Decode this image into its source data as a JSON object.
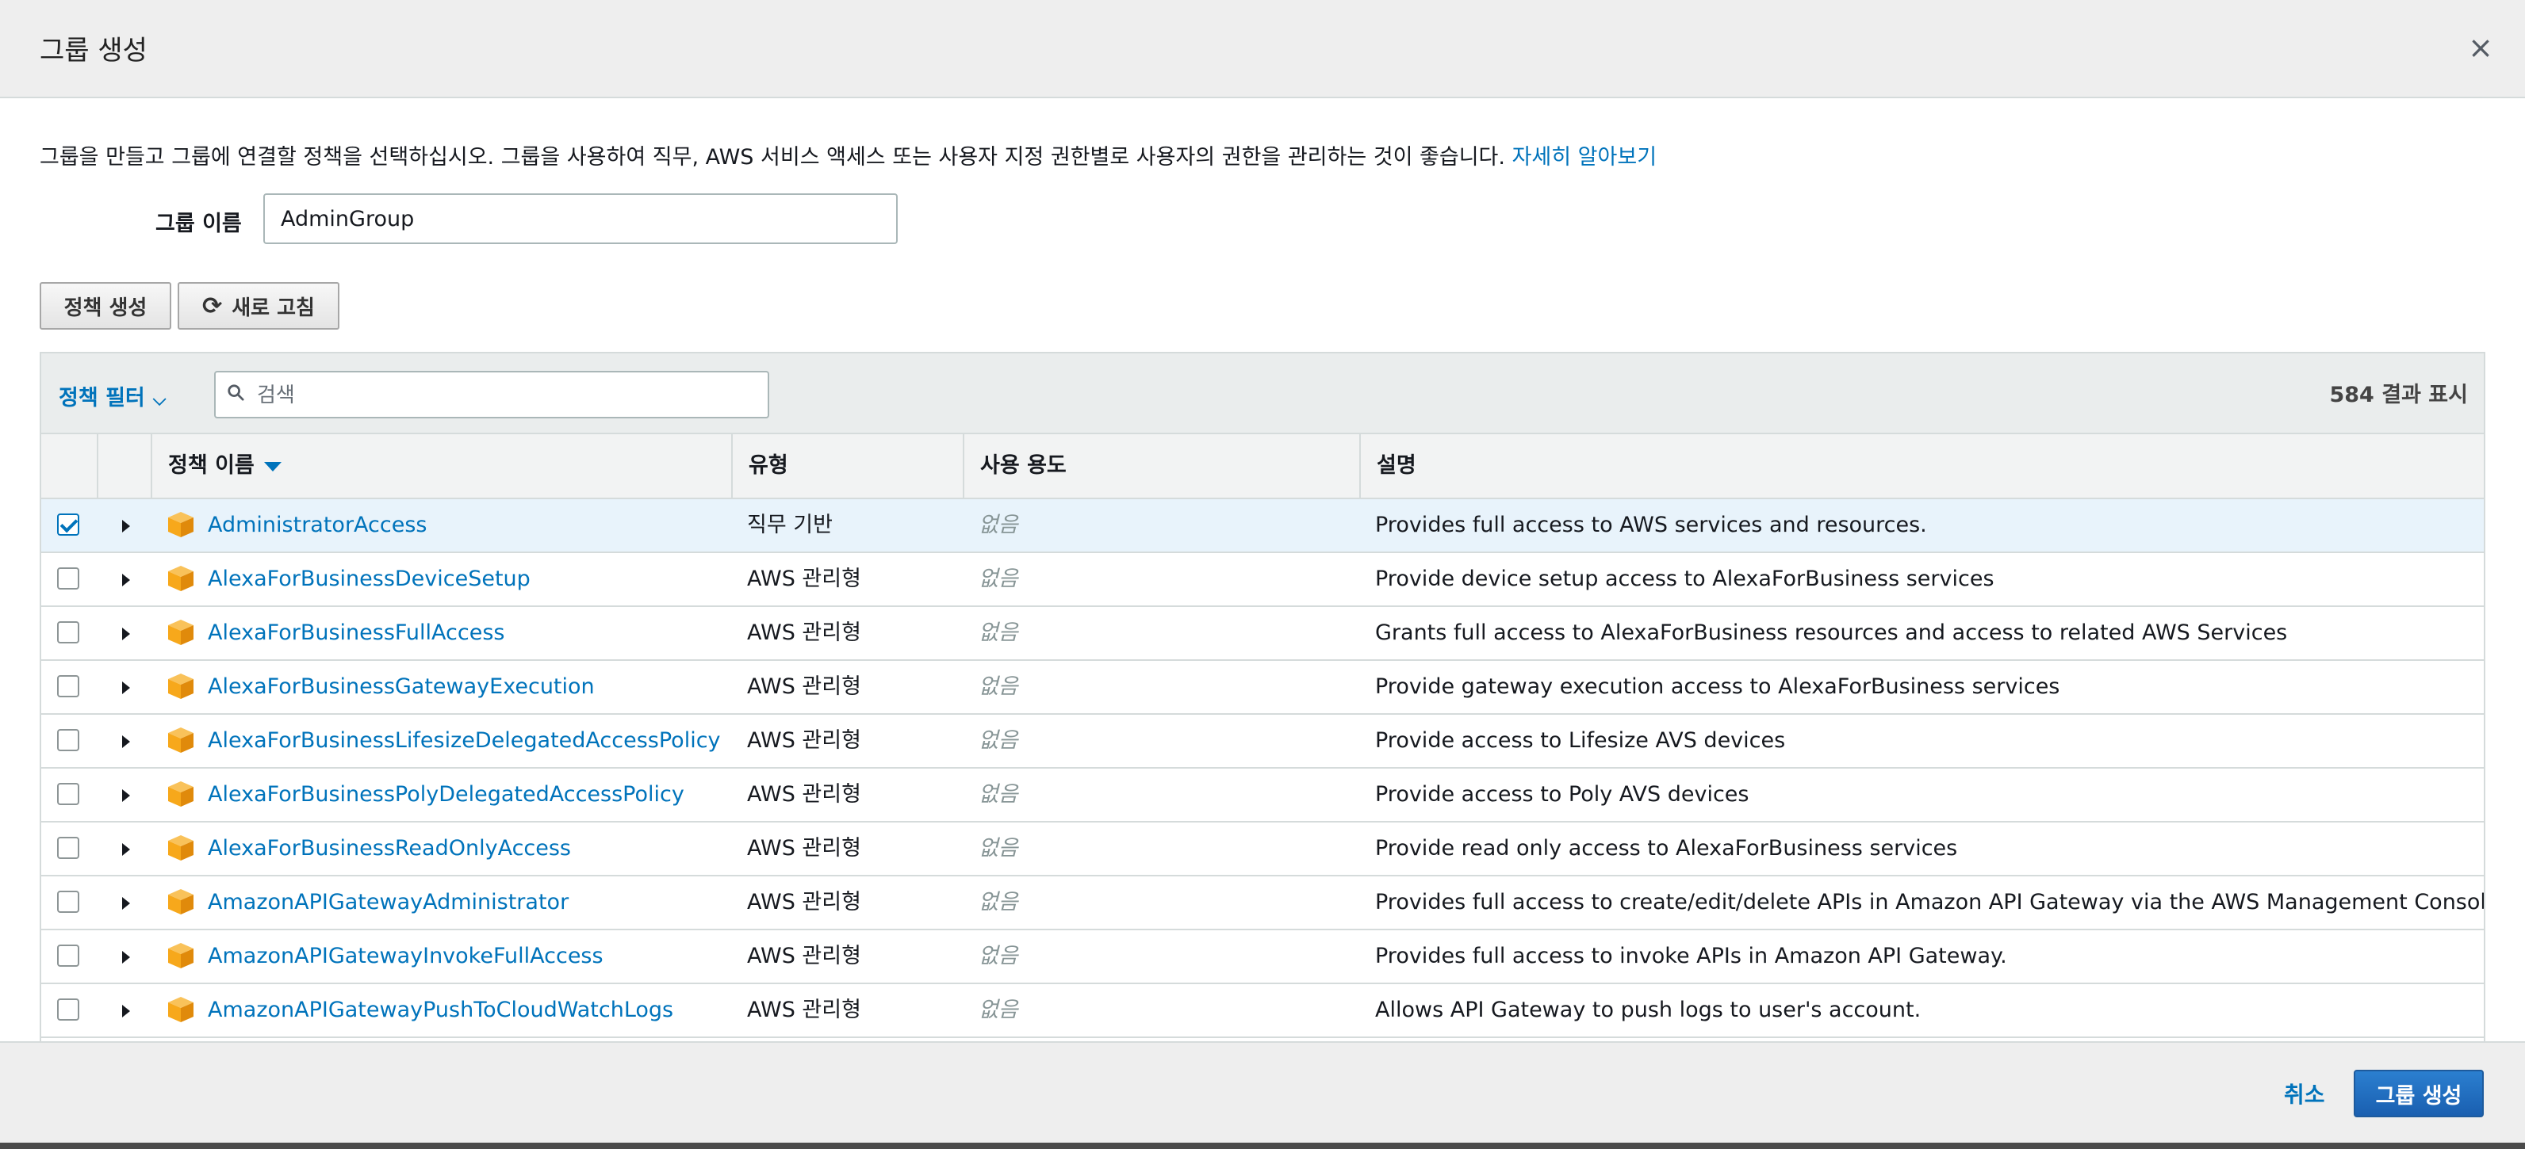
{
  "dialog": {
    "title": "그룹 생성",
    "close_glyph": "×"
  },
  "intro": {
    "text": "그룹을 만들고 그룹에 연결할 정책을 선택하십시오. 그룹을 사용하여 직무, AWS 서비스 액세스 또는 사용자 지정 권한별로 사용자의 권한을 관리하는 것이 좋습니다.",
    "link": "자세히 알아보기"
  },
  "group_name": {
    "label": "그룹 이름",
    "value": "AdminGroup"
  },
  "actions": {
    "create_policy": "정책 생성",
    "refresh": "새로 고침"
  },
  "toolbar": {
    "filter_label": "정책 필터",
    "search_placeholder": "검색",
    "result_count": "584 결과 표시"
  },
  "columns": {
    "name": "정책 이름",
    "type": "유형",
    "usage": "사용 용도",
    "description": "설명"
  },
  "rows": [
    {
      "name": "AdministratorAccess",
      "type": "직무 기반",
      "usage": "없음",
      "description": "Provides full access to AWS services and resources.",
      "checked": true
    },
    {
      "name": "AlexaForBusinessDeviceSetup",
      "type": "AWS 관리형",
      "usage": "없음",
      "description": "Provide device setup access to AlexaForBusiness services",
      "checked": false
    },
    {
      "name": "AlexaForBusinessFullAccess",
      "type": "AWS 관리형",
      "usage": "없음",
      "description": "Grants full access to AlexaForBusiness resources and access to related AWS Services",
      "checked": false
    },
    {
      "name": "AlexaForBusinessGatewayExecution",
      "type": "AWS 관리형",
      "usage": "없음",
      "description": "Provide gateway execution access to AlexaForBusiness services",
      "checked": false
    },
    {
      "name": "AlexaForBusinessLifesizeDelegatedAccessPolicy",
      "type": "AWS 관리형",
      "usage": "없음",
      "description": "Provide access to Lifesize AVS devices",
      "checked": false
    },
    {
      "name": "AlexaForBusinessPolyDelegatedAccessPolicy",
      "type": "AWS 관리형",
      "usage": "없음",
      "description": "Provide access to Poly AVS devices",
      "checked": false
    },
    {
      "name": "AlexaForBusinessReadOnlyAccess",
      "type": "AWS 관리형",
      "usage": "없음",
      "description": "Provide read only access to AlexaForBusiness services",
      "checked": false
    },
    {
      "name": "AmazonAPIGatewayAdministrator",
      "type": "AWS 관리형",
      "usage": "없음",
      "description": "Provides full access to create/edit/delete APIs in Amazon API Gateway via the AWS Management Console.",
      "checked": false
    },
    {
      "name": "AmazonAPIGatewayInvokeFullAccess",
      "type": "AWS 관리형",
      "usage": "없음",
      "description": "Provides full access to invoke APIs in Amazon API Gateway.",
      "checked": false
    },
    {
      "name": "AmazonAPIGatewayPushToCloudWatchLogs",
      "type": "AWS 관리형",
      "usage": "없음",
      "description": "Allows API Gateway to push logs to user's account.",
      "checked": false
    }
  ],
  "footer": {
    "cancel": "취소",
    "submit": "그룹 생성"
  },
  "colors": {
    "link": "#0073bb",
    "policy_icon": "#f7a81b",
    "selected_row": "#e8f3fb",
    "primary": "#1f6fc5"
  },
  "icons": {
    "close": "close-icon",
    "refresh": "refresh-icon",
    "search": "search-icon",
    "sort": "sort-desc-icon",
    "policy": "policy-cube-icon",
    "expand": "expand-caret-icon"
  }
}
